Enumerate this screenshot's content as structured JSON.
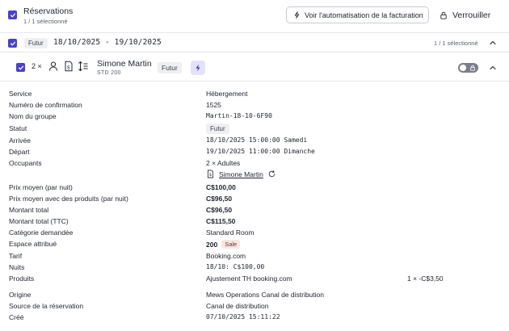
{
  "colors": {
    "accent": "#4a3fd6",
    "chip_purple": "#e4e1fb",
    "pill_gray": "#efeff3",
    "sale_bg": "#fbe5e1"
  },
  "header": {
    "title": "Réservations",
    "subtitle": "1 / 1 sélectionné",
    "automation_button": "Voir l'automatisation de la facturation",
    "lock_button": "Verrouiller"
  },
  "group": {
    "status": "Futur",
    "dates": "18/10/2025 - 19/10/2025",
    "selected_count": "1 / 1 sélectionné"
  },
  "reservation": {
    "count": "2 ×",
    "guest_name": "Simone Martin",
    "room_code": "STD 200",
    "status": "Futur"
  },
  "details": {
    "service": {
      "label": "Service",
      "value": "Hébergement"
    },
    "confirmation": {
      "label": "Numéro de confirmation",
      "value": "1525"
    },
    "group_name": {
      "label": "Nom du groupe",
      "value": "Martin-18-10-6F90"
    },
    "status": {
      "label": "Statut",
      "value": "Futur"
    },
    "arrival": {
      "label": "Arrivée",
      "value": "18/10/2025 15:00:00 Samedi"
    },
    "departure": {
      "label": "Départ",
      "value": "19/10/2025 11:00:00 Dimanche"
    },
    "occupants": {
      "label": "Occupants",
      "value": "2 × Adultes",
      "guest": "Simone Martin"
    },
    "avg_price": {
      "label": "Prix moyen (par nuit)",
      "value": "C$100,00"
    },
    "avg_price_products": {
      "label": "Prix moyen avec des produits (par nuit)",
      "value": "C$96,50"
    },
    "total": {
      "label": "Montant total",
      "value": "C$96,50"
    },
    "total_ttc": {
      "label": "Montant total (TTC)",
      "value": "C$115,50"
    },
    "category": {
      "label": "Catégorie demandée",
      "value": "Standard Room"
    },
    "space": {
      "label": "Espace attribué",
      "value": "200",
      "tag": "Sale"
    },
    "rate": {
      "label": "Tarif",
      "value": "Booking.com"
    },
    "nights": {
      "label": "Nuits",
      "value": "18/10: C$100,00"
    },
    "products": {
      "label": "Produits",
      "value": "Ajustement TH booking.com",
      "amount": "1 × -C$3,50"
    },
    "origin": {
      "label": "Origine",
      "value": "Mews Operations Canal de distribution"
    },
    "source": {
      "label": "Source de la réservation",
      "value": "Canal de distribution"
    },
    "created": {
      "label": "Créé",
      "value": "07/10/2025 15:11:22"
    }
  },
  "icons": {
    "checkbox": "check-icon",
    "automation": "bolt-icon",
    "lock": "lock-icon",
    "collapse": "chevron-up-icon",
    "person": "person-icon",
    "billing": "dollar-document-icon",
    "sort": "sort-icon",
    "refresh": "refresh-icon"
  }
}
